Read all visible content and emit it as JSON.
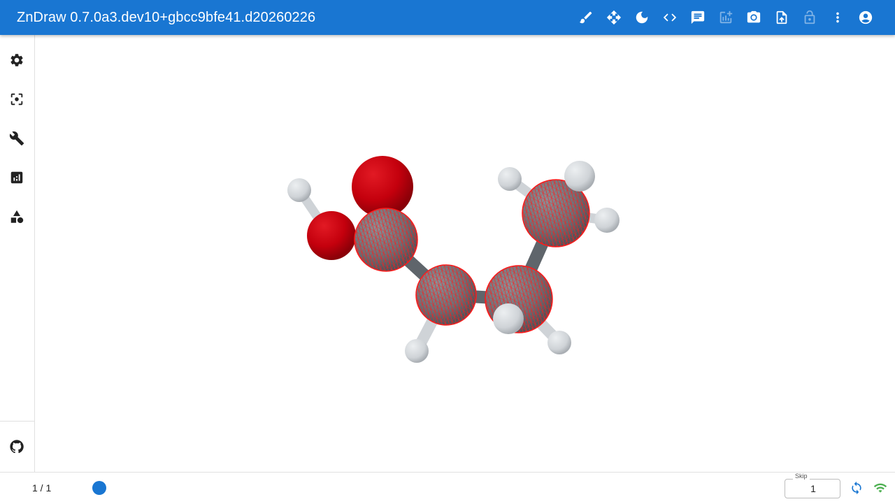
{
  "app": {
    "title": "ZnDraw 0.7.0a3.dev10+gbcc9bfe41.d20260226"
  },
  "toolbar": {
    "items": [
      {
        "icon": "brush-icon"
      },
      {
        "icon": "move-arrows-icon"
      },
      {
        "icon": "moon-icon"
      },
      {
        "icon": "code-icon"
      },
      {
        "icon": "chat-icon"
      },
      {
        "icon": "add-chart-icon"
      },
      {
        "icon": "camera-icon"
      },
      {
        "icon": "file-upload-icon"
      },
      {
        "icon": "lock-open-icon"
      },
      {
        "icon": "more-vertical-icon"
      },
      {
        "icon": "account-icon"
      }
    ]
  },
  "sidebar": {
    "items": [
      {
        "icon": "gear-icon"
      },
      {
        "icon": "center-focus-icon"
      },
      {
        "icon": "wrench-icon"
      },
      {
        "icon": "analytics-icon"
      },
      {
        "icon": "shapes-icon"
      }
    ],
    "footer": {
      "icon": "github-icon"
    }
  },
  "bottom": {
    "frame_counter": "1 / 1",
    "skip_label": "Skip",
    "skip_value": "1",
    "sync_icon": "sync-icon",
    "wifi_icon": "wifi-icon",
    "accent": "#1976d2",
    "connected_color": "#4caf50"
  },
  "colors": {
    "appbar": "#1976d2",
    "oxygen": "#c8000e",
    "carbon": "#6b7177",
    "hydrogen": "#d3d7db",
    "selection": "#ff1a1a"
  }
}
